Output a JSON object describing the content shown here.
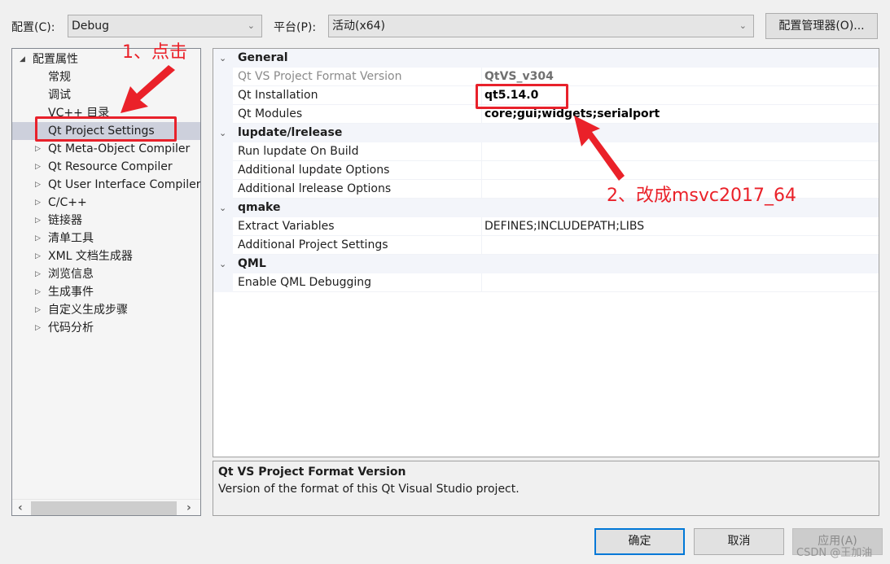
{
  "toolbar": {
    "config_label": "配置(C):",
    "config_value": "Debug",
    "platform_label": "平台(P):",
    "platform_value": "活动(x64)",
    "config_manager_button": "配置管理器(O)..."
  },
  "tree": {
    "root": "配置属性",
    "items": [
      {
        "label": "常规",
        "expandable": false
      },
      {
        "label": "调试",
        "expandable": false
      },
      {
        "label": "VC++ 目录",
        "expandable": false
      },
      {
        "label": "Qt Project Settings",
        "expandable": false,
        "selected": true
      },
      {
        "label": "Qt Meta-Object Compiler",
        "expandable": true
      },
      {
        "label": "Qt Resource Compiler",
        "expandable": true
      },
      {
        "label": "Qt User Interface Compiler",
        "expandable": true
      },
      {
        "label": "C/C++",
        "expandable": true
      },
      {
        "label": "链接器",
        "expandable": true
      },
      {
        "label": "清单工具",
        "expandable": true
      },
      {
        "label": "XML 文档生成器",
        "expandable": true
      },
      {
        "label": "浏览信息",
        "expandable": true
      },
      {
        "label": "生成事件",
        "expandable": true
      },
      {
        "label": "自定义生成步骤",
        "expandable": true
      },
      {
        "label": "代码分析",
        "expandable": true
      }
    ]
  },
  "grid": {
    "categories": [
      {
        "name": "General",
        "props": [
          {
            "name": "Qt VS Project Format Version",
            "value": "QtVS_v304",
            "dim": true,
            "bold": true
          },
          {
            "name": "Qt Installation",
            "value": "qt5.14.0",
            "bold": true
          },
          {
            "name": "Qt Modules",
            "value": "core;gui;widgets;serialport",
            "bold": true
          }
        ]
      },
      {
        "name": "lupdate/lrelease",
        "props": [
          {
            "name": "Run lupdate On Build",
            "value": ""
          },
          {
            "name": "Additional lupdate Options",
            "value": ""
          },
          {
            "name": "Additional lrelease Options",
            "value": ""
          }
        ]
      },
      {
        "name": "qmake",
        "props": [
          {
            "name": "Extract Variables",
            "value": "DEFINES;INCLUDEPATH;LIBS"
          },
          {
            "name": "Additional Project Settings",
            "value": ""
          }
        ]
      },
      {
        "name": "QML",
        "props": [
          {
            "name": "Enable QML Debugging",
            "value": ""
          }
        ]
      }
    ]
  },
  "description": {
    "title": "Qt VS Project Format Version",
    "body": "Version of the format of this Qt Visual Studio project."
  },
  "buttons": {
    "ok": "确定",
    "cancel": "取消",
    "apply": "应用(A)"
  },
  "annotations": {
    "step1": "1、点击",
    "step2": "2、改成msvc2017_64",
    "color": "#ea2129"
  },
  "watermark": "CSDN @王加油"
}
